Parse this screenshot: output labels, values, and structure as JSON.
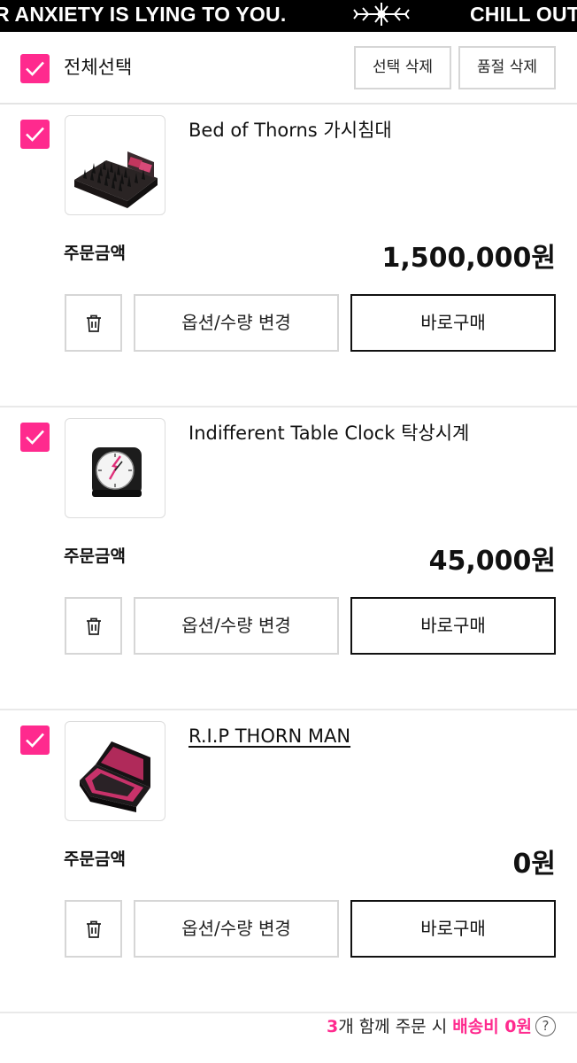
{
  "banner": {
    "left_text": "R ANXIETY IS LYING TO YOU.",
    "right_text": "CHILL OUT"
  },
  "select_all": {
    "checked": true,
    "label": "전체선택",
    "delete_selected_label": "선택 삭제",
    "delete_soldout_label": "품절 삭제"
  },
  "items": [
    {
      "checked": true,
      "name": "Bed of Thorns 가시침대",
      "amount_label": "주문금액",
      "amount": "1,500,000원",
      "option_label": "옵션/수량 변경",
      "buy_label": "바로구매"
    },
    {
      "checked": true,
      "name": "Indifferent Table Clock 탁상시계",
      "amount_label": "주문금액",
      "amount": "45,000원",
      "option_label": "옵션/수량 변경",
      "buy_label": "바로구매"
    },
    {
      "checked": true,
      "name": "R.I.P THORN MAN",
      "amount_label": "주문금액",
      "amount": "0원",
      "option_label": "옵션/수량 변경",
      "buy_label": "바로구매"
    }
  ],
  "footer": {
    "count": "3",
    "text_a": "개 함께 주문 시 ",
    "shipping_label": "배송비 0원",
    "help_glyph": "?"
  },
  "colors": {
    "accent": "#ff2a8e",
    "banner_bg": "#000000",
    "border": "#d6d6d6"
  },
  "icons": {
    "checkbox": "check-icon",
    "delete": "trash-icon",
    "help": "question-circle-icon",
    "logo": "thorn-cross-logo"
  }
}
